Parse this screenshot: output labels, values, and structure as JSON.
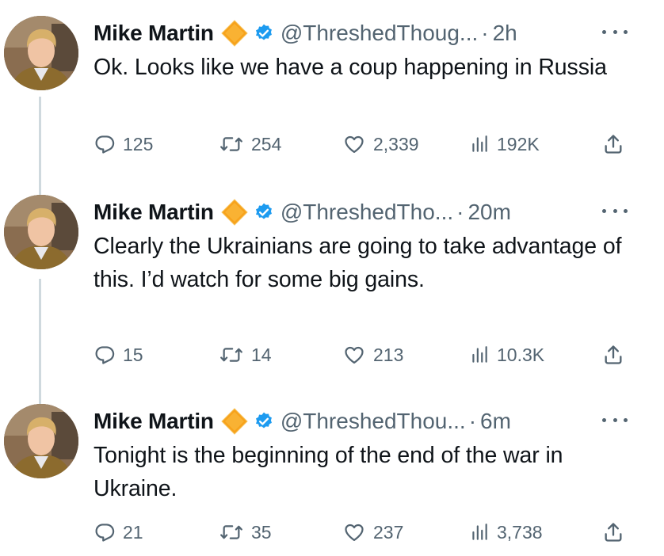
{
  "tweets": [
    {
      "author": "Mike Martin",
      "handle": "@ThreshedThoug...",
      "time": "2h",
      "text": "Ok. Looks like we have a coup happening in Russia",
      "replies": "125",
      "retweets": "254",
      "likes": "2,339",
      "views": "192K"
    },
    {
      "author": "Mike Martin",
      "handle": "@ThreshedTho...",
      "time": "20m",
      "text": "Clearly the Ukrainians are going to take advantage of this. I’d watch for some big gains.",
      "replies": "15",
      "retweets": "14",
      "likes": "213",
      "views": "10.3K"
    },
    {
      "author": "Mike Martin",
      "handle": "@ThreshedThou...",
      "time": "6m",
      "text": "Tonight is the beginning of the end of the war in Ukraine.",
      "replies": "21",
      "retweets": "35",
      "likes": "237",
      "views": "3,738"
    }
  ],
  "separator": "·",
  "icons": {
    "gold_badge": "affiliate-diamond-icon",
    "blue_badge": "verified-check-icon",
    "reply": "reply-icon",
    "retweet": "retweet-icon",
    "like": "heart-icon",
    "views": "views-bar-chart-icon",
    "share": "share-icon",
    "more": "more-dots-icon"
  },
  "colors": {
    "text": "#0f1419",
    "secondary": "#536471",
    "verified_blue": "#1d9bf0",
    "gold_badge": "#f7a21b",
    "thread_line": "#cfd9de"
  }
}
